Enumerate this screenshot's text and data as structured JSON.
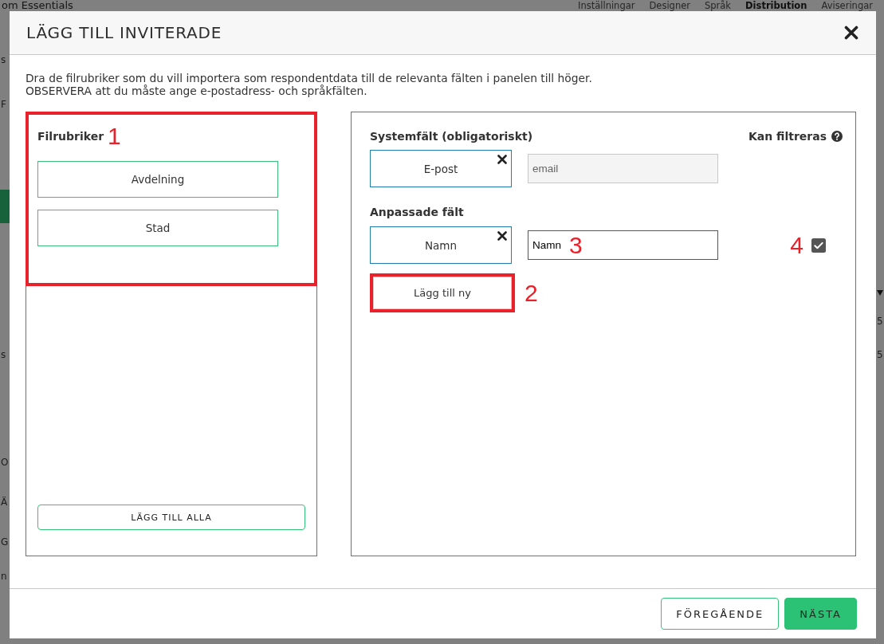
{
  "background": {
    "page_title": "om Essentials",
    "tabs": [
      {
        "label": "Inställningar",
        "selected": false
      },
      {
        "label": "Designer",
        "selected": false
      },
      {
        "label": "Språk",
        "selected": false
      },
      {
        "label": "Distribution",
        "selected": true
      },
      {
        "label": "Aviseringar",
        "selected": false
      }
    ],
    "left_edge": [
      {
        "kind": "text",
        "text": "s"
      },
      {
        "kind": "text",
        "text": "F"
      },
      {
        "kind": "button"
      },
      {
        "kind": "text",
        "text": "s"
      },
      {
        "kind": "text",
        "text": "O"
      },
      {
        "kind": "text",
        "text": "Ä"
      },
      {
        "kind": "text",
        "text": "G"
      },
      {
        "kind": "text",
        "text": "n"
      }
    ],
    "right_edge": [
      {
        "kind": "caret"
      },
      {
        "kind": "text",
        "text": "5"
      },
      {
        "kind": "text",
        "text": "5"
      }
    ]
  },
  "dialog": {
    "title": "LÄGG TILL INVITERADE",
    "instructions": [
      "Dra de filrubriker som du vill importera som respondentdata till de relevanta fälten i panelen till höger.",
      "OBSERVERA att du måste ange e-postadress- och språkfälten."
    ],
    "file_headers": {
      "title": "Filrubriker",
      "marker": "1",
      "highlighted": true,
      "items": [
        "Avdelning",
        "Stad"
      ],
      "add_all_button": "LÄGG TILL ALLA"
    },
    "fields": {
      "system_title": "Systemfält (obligatoriskt)",
      "filter_title": "Kan filtreras",
      "system_fields": [
        {
          "source": "E-post",
          "value": "email",
          "disabled": true
        }
      ],
      "custom_title": "Anpassade fält",
      "custom_fields": [
        {
          "source": "Namn",
          "value": "Namn",
          "disabled": false,
          "marker": "3",
          "filterable": true,
          "filter_marker": "4"
        }
      ],
      "add_button": {
        "label": "Lägg till ny",
        "marker": "2",
        "highlighted": true
      }
    },
    "footer": {
      "buttons": [
        {
          "label": "FÖREGÅENDE",
          "kind": "secondary"
        },
        {
          "label": "NÄSTA",
          "kind": "primary"
        }
      ]
    }
  }
}
